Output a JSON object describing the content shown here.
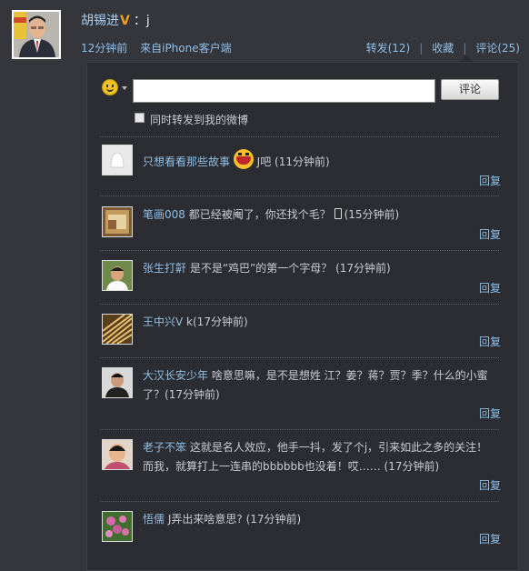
{
  "post": {
    "author": "胡锡进",
    "verified_mark": "V",
    "text": "：j",
    "time": "12分钟前",
    "source": "来自iPhone客户端",
    "actions": {
      "forward": "转发(12)",
      "favorite": "收藏",
      "comment": "评论(25)"
    }
  },
  "composer": {
    "input_value": "",
    "submit_label": "评论",
    "forward_label": "同时转发到我的微博",
    "forward_checked": false
  },
  "reply_label": "回复",
  "comments": [
    {
      "user": "只想看看那些故事",
      "text": "J吧",
      "time": "(11分钟前)"
    },
    {
      "user": "笔画008",
      "text": "都已经被阉了，你还找个毛？",
      "time": "(15分钟前)"
    },
    {
      "user": "张生打鼾",
      "text": "是不是“鸡巴”的第一个字母？",
      "time": "(17分钟前)"
    },
    {
      "user": "王中兴V",
      "text": "k",
      "time": "(17分钟前)"
    },
    {
      "user": "大汉长安少年",
      "text": "啥意思嘛，是不是想姓 江？姜？蒋？贾？季？什么的小蜜了？",
      "time": "(17分钟前)"
    },
    {
      "user": "老子不笨",
      "text": "这就是名人效应，他手一抖，发了个j，引来如此之多的关注！而我，就算打上一连串的bbbbbb也没着！哎……",
      "time": "(17分钟前)"
    },
    {
      "user": "悟儒",
      "text": "J弄出来啥意思?",
      "time": "(17分钟前)"
    }
  ]
}
